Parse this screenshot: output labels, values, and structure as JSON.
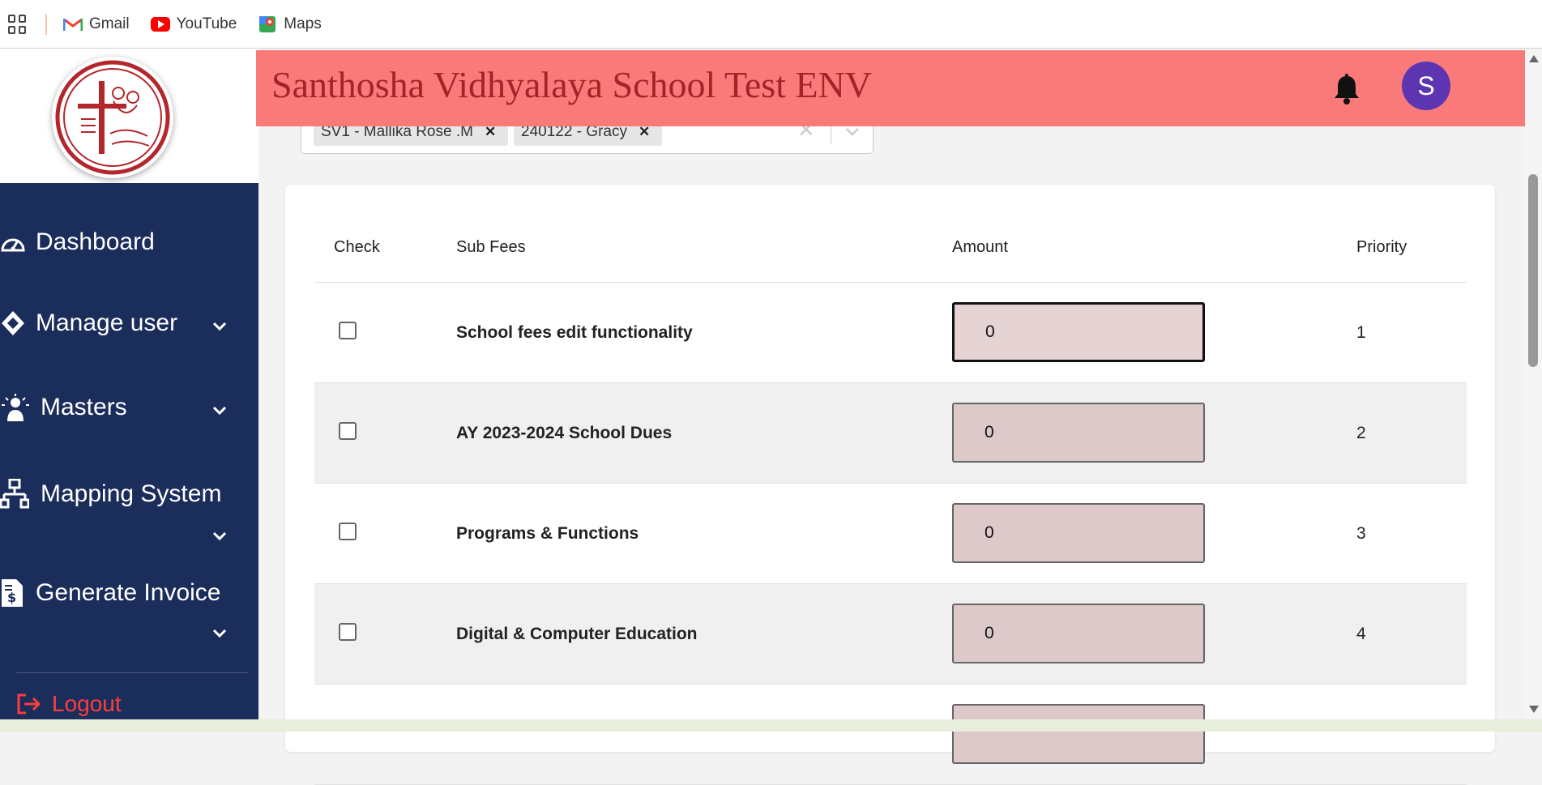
{
  "bookmarks": [
    {
      "label": "Gmail",
      "icon": "gmail-icon"
    },
    {
      "label": "YouTube",
      "icon": "youtube-icon"
    },
    {
      "label": "Maps",
      "icon": "maps-icon"
    }
  ],
  "header": {
    "title": "Santhosha Vidhyalaya School Test ENV",
    "avatar_letter": "S",
    "color": "#fa7a7a"
  },
  "sidebar": {
    "items": [
      {
        "label": "Dashboard",
        "icon": "dashboard-icon"
      },
      {
        "label": "Manage user",
        "icon": "manage-user-icon"
      },
      {
        "label": "Masters",
        "icon": "masters-icon"
      },
      {
        "label": "Mapping System",
        "icon": "sitemap-icon"
      },
      {
        "label": "Generate Invoice",
        "icon": "invoice-icon"
      }
    ],
    "logout": "Logout",
    "color": "#1b2d5a"
  },
  "student_select": {
    "tags": [
      "SV1 - Mallika Rose .M",
      "240122 - Gracy"
    ]
  },
  "table": {
    "headers": {
      "check": "Check",
      "sub_fees": "Sub Fees",
      "amount": "Amount",
      "priority": "Priority"
    },
    "rows": [
      {
        "name": "School fees edit functionality",
        "amount": "0",
        "priority": "1"
      },
      {
        "name": "AY 2023-2024 School Dues",
        "amount": "0",
        "priority": "2"
      },
      {
        "name": "Programs & Functions",
        "amount": "0",
        "priority": "3"
      },
      {
        "name": "Digital & Computer Education",
        "amount": "0",
        "priority": "4"
      }
    ]
  }
}
